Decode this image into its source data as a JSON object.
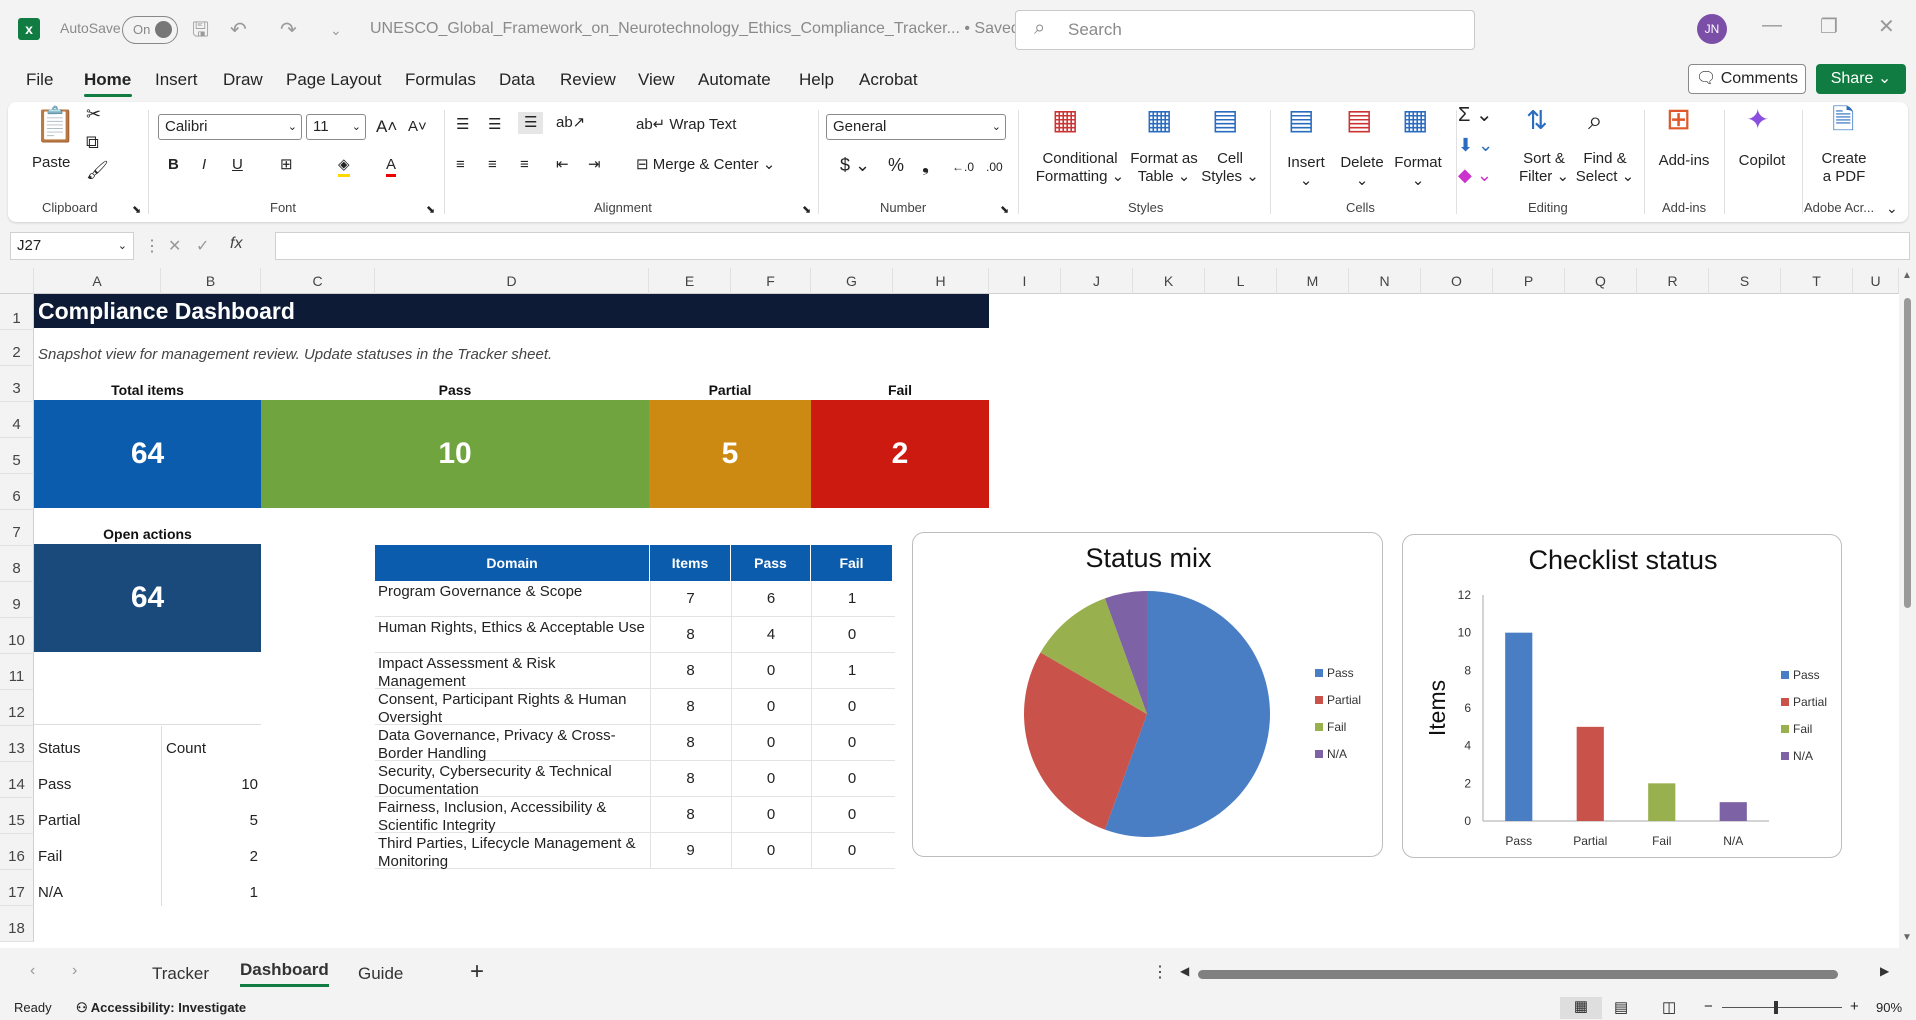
{
  "window": {
    "autosave_label": "AutoSave",
    "autosave_state": "On",
    "doc_title": "UNESCO_Global_Framework_on_Neurotechnology_Ethics_Compliance_Tracker...  •  Saved",
    "search_placeholder": "Search",
    "user_initials": "JN"
  },
  "menu": [
    "File",
    "Home",
    "Insert",
    "Draw",
    "Page Layout",
    "Formulas",
    "Data",
    "Review",
    "View",
    "Automate",
    "Help",
    "Acrobat"
  ],
  "actions": {
    "comments": "Comments",
    "share": "Share"
  },
  "ribbon": {
    "clipboard": {
      "paste": "Paste",
      "label": "Clipboard"
    },
    "font": {
      "name": "Calibri",
      "size": "11",
      "label": "Font"
    },
    "alignment": {
      "wrap": "Wrap Text",
      "merge": "Merge & Center",
      "label": "Alignment"
    },
    "number": {
      "format": "General",
      "label": "Number"
    },
    "styles": {
      "cond1": "Conditional",
      "cond2": "Formatting",
      "fmt1": "Format as",
      "fmt2": "Table",
      "cell1": "Cell",
      "cell2": "Styles",
      "label": "Styles"
    },
    "cells": {
      "insert": "Insert",
      "delete": "Delete",
      "format": "Format",
      "label": "Cells"
    },
    "editing": {
      "sort1": "Sort &",
      "sort2": "Filter",
      "find1": "Find &",
      "find2": "Select",
      "label": "Editing"
    },
    "addins": {
      "addins": "Add-ins",
      "label": "Add-ins"
    },
    "copilot": {
      "label": "Copilot"
    },
    "acrobat": {
      "create1": "Create",
      "create2": "a PDF",
      "label": "Adobe Acr..."
    }
  },
  "formula_bar": {
    "name_box": "J27",
    "fx": "fx"
  },
  "columns": [
    "A",
    "B",
    "C",
    "D",
    "E",
    "F",
    "G",
    "H",
    "I",
    "J",
    "K",
    "L",
    "M",
    "N",
    "O",
    "P",
    "Q",
    "R",
    "S",
    "T",
    "U"
  ],
  "rows": [
    "1",
    "2",
    "3",
    "4",
    "5",
    "6",
    "7",
    "8",
    "9",
    "10",
    "11",
    "12",
    "13",
    "14",
    "15",
    "16",
    "17",
    "18"
  ],
  "dashboard": {
    "title": "Compliance Dashboard",
    "subtitle": "Snapshot view for management review. Update statuses in the Tracker sheet.",
    "kpis": [
      {
        "label": "Total items",
        "value": "64",
        "color": "#0b5cad"
      },
      {
        "label": "Pass",
        "value": "10",
        "color": "#70a43e"
      },
      {
        "label": "Partial",
        "value": "5",
        "color": "#cc8a12"
      },
      {
        "label": "Fail",
        "value": "2",
        "color": "#cc1a10"
      }
    ],
    "open_actions": {
      "label": "Open actions",
      "value": "64",
      "color": "#1a4a7c"
    },
    "status_table": {
      "headers": [
        "Status",
        "Count"
      ],
      "rows": [
        [
          "Pass",
          "10"
        ],
        [
          "Partial",
          "5"
        ],
        [
          "Fail",
          "2"
        ],
        [
          "N/A",
          "1"
        ]
      ]
    },
    "domain_table": {
      "headers": [
        "Domain",
        "Items",
        "Pass",
        "Fail"
      ],
      "rows": [
        [
          "Program Governance & Scope",
          "7",
          "6",
          "1"
        ],
        [
          "Human Rights, Ethics & Acceptable Use",
          "8",
          "4",
          "0"
        ],
        [
          "Impact Assessment & Risk Management",
          "8",
          "0",
          "1"
        ],
        [
          "Consent, Participant Rights & Human Oversight",
          "8",
          "0",
          "0"
        ],
        [
          "Data Governance, Privacy & Cross-Border Handling",
          "8",
          "0",
          "0"
        ],
        [
          "Security, Cybersecurity & Technical Documentation",
          "8",
          "0",
          "0"
        ],
        [
          "Fairness, Inclusion, Accessibility & Scientific Integrity",
          "8",
          "0",
          "0"
        ],
        [
          "Third Parties, Lifecycle Management & Monitoring",
          "9",
          "0",
          "0"
        ]
      ]
    }
  },
  "chart_data": [
    {
      "type": "pie",
      "title": "Status mix",
      "categories": [
        "Pass",
        "Partial",
        "Fail",
        "N/A"
      ],
      "values": [
        10,
        5,
        2,
        1
      ],
      "colors": [
        "#4a7ec4",
        "#c9524a",
        "#98b04e",
        "#7d62a6"
      ],
      "legend": "right"
    },
    {
      "type": "bar",
      "title": "Checklist status",
      "categories": [
        "Pass",
        "Partial",
        "Fail",
        "N/A"
      ],
      "values": [
        10,
        5,
        2,
        1
      ],
      "colors": [
        "#4a7ec4",
        "#c9524a",
        "#98b04e",
        "#7d62a6"
      ],
      "ylabel": "Items",
      "ylim": [
        0,
        12
      ],
      "yticks": [
        "0",
        "2",
        "4",
        "6",
        "8",
        "10",
        "12"
      ],
      "legend": "right",
      "grid": false
    }
  ],
  "sheet_tabs": [
    "Tracker",
    "Dashboard",
    "Guide"
  ],
  "status": {
    "ready": "Ready",
    "accessibility": "Accessibility: Investigate",
    "zoom": "90%"
  }
}
